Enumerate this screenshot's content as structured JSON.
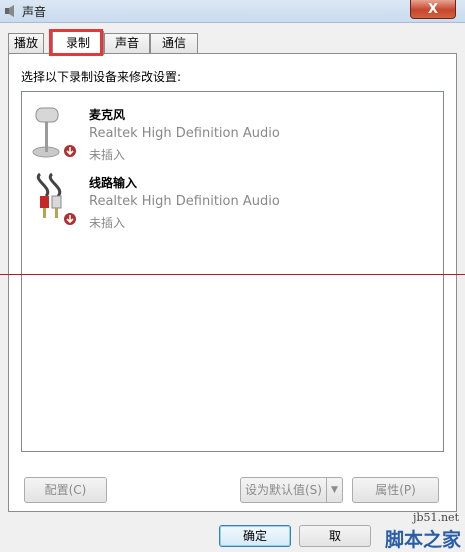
{
  "window": {
    "title": "声音",
    "close_label": "X"
  },
  "tabs": [
    {
      "label": "播放",
      "active": false
    },
    {
      "label": "录制",
      "active": true
    },
    {
      "label": "声音",
      "active": false
    },
    {
      "label": "通信",
      "active": false
    }
  ],
  "panel": {
    "instruction": "选择以下录制设备来修改设置:",
    "devices": [
      {
        "name": "麦克风",
        "driver": "Realtek High Definition Audio",
        "status": "未插入",
        "icon": "microphone-icon"
      },
      {
        "name": "线路输入",
        "driver": "Realtek High Definition Audio",
        "status": "未插入",
        "icon": "line-in-icon"
      }
    ]
  },
  "buttons": {
    "configure": "配置(C)",
    "set_default": "设为默认值(S)",
    "set_default_arrow": "▼",
    "properties": "属性(P)",
    "ok": "确定",
    "cancel_partial": "取"
  },
  "watermark": {
    "url": "jb51.net",
    "name": "脚本之家"
  },
  "colors": {
    "highlight": "#e23a3a",
    "annotation_line": "#b21e1e",
    "accent": "#3c7fb1"
  }
}
